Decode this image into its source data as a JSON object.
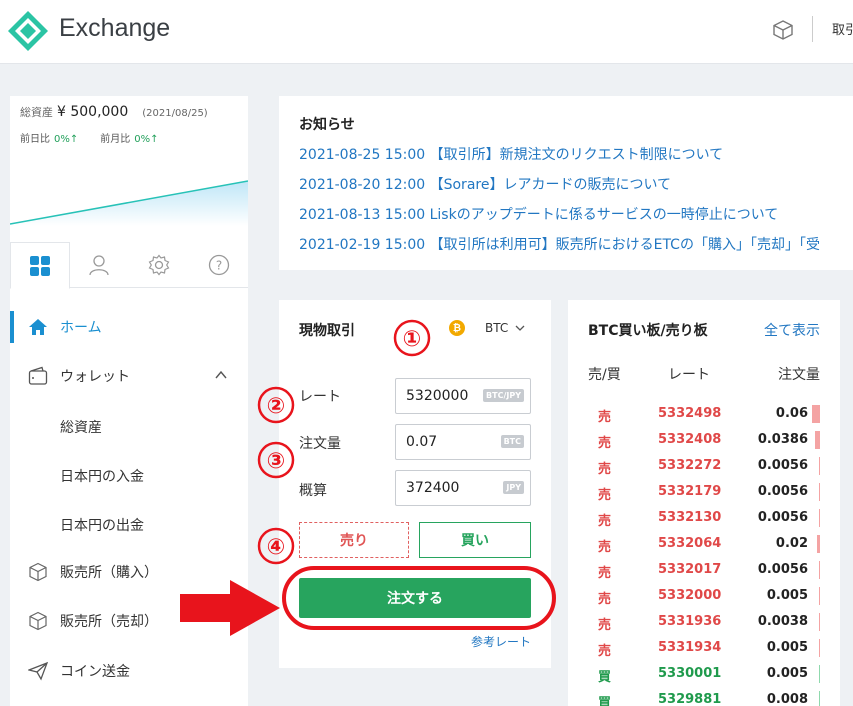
{
  "header": {
    "brand": "Exchange",
    "link": "取引所"
  },
  "sidebar": {
    "total_label": "総資産",
    "total_amount": "¥ 500,000",
    "total_date": "(2021/08/25)",
    "day_label": "前日比",
    "day_value": "0%↑",
    "month_label": "前月比",
    "month_value": "0%↑",
    "menu": {
      "home": "ホーム",
      "wallet": "ウォレット",
      "total_assets": "総資産",
      "jpy_deposit": "日本円の入金",
      "jpy_withdraw": "日本円の出金",
      "store_buy": "販売所（購入）",
      "store_sell": "販売所（売却）",
      "coin_send": "コイン送金"
    }
  },
  "notice": {
    "title": "お知らせ",
    "items": [
      "2021-08-25 15:00 【取引所】新規注文のリクエスト制限について",
      "2021-08-20 12:00 【Sorare】レアカードの販売について",
      "2021-08-13 15:00 Liskのアップデートに係るサービスの一時停止について",
      "2021-02-19 15:00 【取引所は利用可】販売所におけるETCの「購入」「売却」「受"
    ]
  },
  "trade": {
    "title": "現物取引",
    "coin": "BTC",
    "rate_label": "レート",
    "rate_value": "5320000",
    "rate_unit": "BTC/JPY",
    "amount_label": "注文量",
    "amount_value": "0.07",
    "amount_unit": "BTC",
    "estimate_label": "概算",
    "estimate_value": "372400",
    "estimate_unit": "JPY",
    "sell_label": "売り",
    "buy_label": "買い",
    "order_label": "注文する",
    "ref_rate": "参考レート"
  },
  "book": {
    "title": "BTC買い板/売り板",
    "show_all": "全て表示",
    "col_side": "売/買",
    "col_rate": "レート",
    "col_qty": "注文量",
    "rows": [
      {
        "side": "売",
        "rate": "5332498",
        "qty": "0.06",
        "fill": 0.06
      },
      {
        "side": "売",
        "rate": "5332408",
        "qty": "0.0386",
        "fill": 0.0386
      },
      {
        "side": "売",
        "rate": "5332272",
        "qty": "0.0056",
        "fill": 0.0056
      },
      {
        "side": "売",
        "rate": "5332179",
        "qty": "0.0056",
        "fill": 0.0056
      },
      {
        "side": "売",
        "rate": "5332130",
        "qty": "0.0056",
        "fill": 0.0056
      },
      {
        "side": "売",
        "rate": "5332064",
        "qty": "0.02",
        "fill": 0.02
      },
      {
        "side": "売",
        "rate": "5332017",
        "qty": "0.0056",
        "fill": 0.0056
      },
      {
        "side": "売",
        "rate": "5332000",
        "qty": "0.005",
        "fill": 0.005
      },
      {
        "side": "売",
        "rate": "5331936",
        "qty": "0.0038",
        "fill": 0.0038
      },
      {
        "side": "売",
        "rate": "5331934",
        "qty": "0.005",
        "fill": 0.005
      },
      {
        "side": "買",
        "rate": "5330001",
        "qty": "0.005",
        "fill": 0.005
      },
      {
        "side": "買",
        "rate": "5329881",
        "qty": "0.008",
        "fill": 0.008
      }
    ]
  },
  "annotations": [
    "①",
    "②",
    "③",
    "④"
  ],
  "colors": {
    "accent_blue": "#1a8fd0",
    "buy_green": "#27a45e",
    "sell_red": "#e04848",
    "annotation_red": "#e8141c"
  }
}
